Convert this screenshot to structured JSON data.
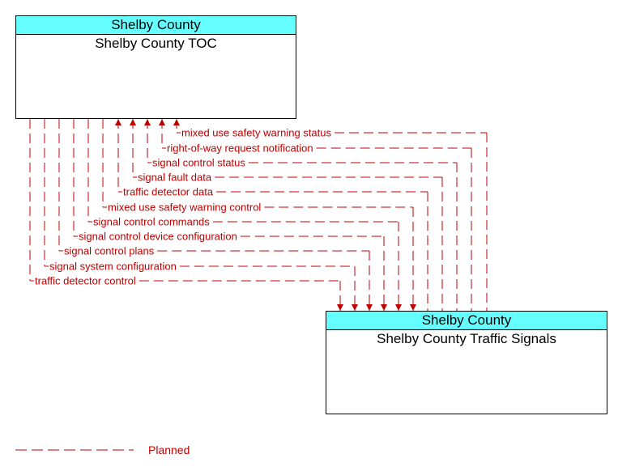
{
  "colors": {
    "flow": "#c00000",
    "header_fill": "#66ffff",
    "border": "#000000"
  },
  "elements": {
    "toc": {
      "owner": "Shelby County",
      "name": "Shelby County TOC"
    },
    "signals": {
      "owner": "Shelby County",
      "name": "Shelby County Traffic Signals"
    }
  },
  "flows": [
    {
      "label": "mixed use safety warning status",
      "from": "signals",
      "to": "toc",
      "status": "Planned"
    },
    {
      "label": "right-of-way request notification",
      "from": "signals",
      "to": "toc",
      "status": "Planned"
    },
    {
      "label": "signal control status",
      "from": "signals",
      "to": "toc",
      "status": "Planned"
    },
    {
      "label": "signal fault data",
      "from": "signals",
      "to": "toc",
      "status": "Planned"
    },
    {
      "label": "traffic detector data",
      "from": "signals",
      "to": "toc",
      "status": "Planned"
    },
    {
      "label": "mixed use safety warning control",
      "from": "toc",
      "to": "signals",
      "status": "Planned"
    },
    {
      "label": "signal control commands",
      "from": "toc",
      "to": "signals",
      "status": "Planned"
    },
    {
      "label": "signal control device configuration",
      "from": "toc",
      "to": "signals",
      "status": "Planned"
    },
    {
      "label": "signal control plans",
      "from": "toc",
      "to": "signals",
      "status": "Planned"
    },
    {
      "label": "signal system configuration",
      "from": "toc",
      "to": "signals",
      "status": "Planned"
    },
    {
      "label": "traffic detector control",
      "from": "toc",
      "to": "signals",
      "status": "Planned"
    }
  ],
  "legend": {
    "label": "Planned"
  }
}
